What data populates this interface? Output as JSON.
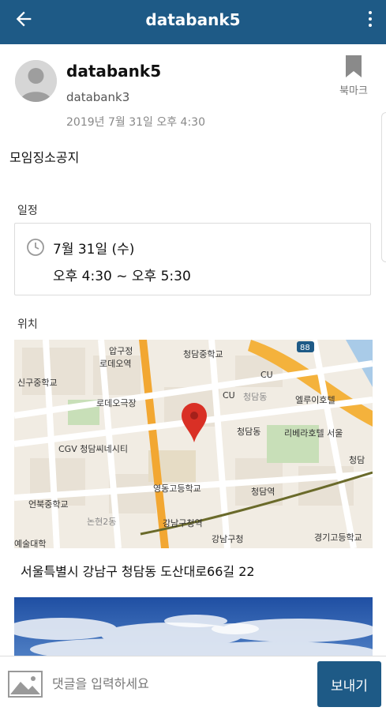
{
  "appbar": {
    "title": "databank5",
    "back_icon": "arrow-left-icon",
    "more_icon": "more-vert-icon",
    "color": "#1e5a86"
  },
  "post": {
    "author": "databank5",
    "handle": "databank3",
    "date": "2019년 7월 31일 오후 4:30",
    "bookmark_label": "북마크",
    "body": "모임징소공지"
  },
  "schedule": {
    "label": "일정",
    "day": "7월 31일 (수)",
    "time": "오후 4:30 ~ 오후 5:30"
  },
  "location": {
    "label": "위치",
    "address": "서울특별시 강남구 청담동 도산대로66길 22",
    "map_labels": {
      "l1": "압구정",
      "l2": "로데오역",
      "l3": "청담중학교",
      "l4": "신구중학교",
      "l5": "CU",
      "l6": "CU",
      "l7": "청담동",
      "l8": "엘루이호텔",
      "l9": "로데오극장",
      "l10": "CGV 청담씨네시티",
      "l11": "청담동",
      "l12": "리베라호텔 서울",
      "l13": "청담",
      "l14": "영동고등학교",
      "l15": "청담역",
      "l16": "언북중학교",
      "l17": "논현2동",
      "l18": "강남구청역",
      "l19": "강남구청",
      "l20": "경기고등학교",
      "l21": "예술대학",
      "l22": "88"
    }
  },
  "comment": {
    "placeholder": "댓글을 입력하세요",
    "send_label": "보내기"
  }
}
